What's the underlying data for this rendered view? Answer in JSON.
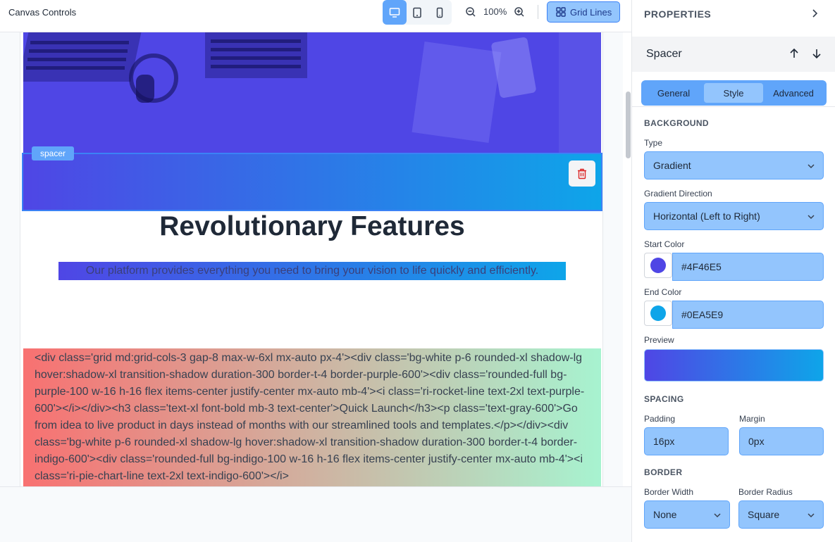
{
  "toolbar": {
    "title": "Canvas Controls",
    "zoom_level": "100%",
    "grid_lines_label": "Grid Lines",
    "devices": [
      "desktop",
      "tablet",
      "mobile"
    ],
    "active_device": "desktop"
  },
  "canvas": {
    "spacer_tag": "spacer",
    "heading": "Revolutionary Features",
    "lead": "Our platform provides everything you need to bring your vision to life quickly and efficiently.",
    "code_text": "<div class='grid md:grid-cols-3 gap-8 max-w-6xl mx-auto px-4'><div class='bg-white p-6 rounded-xl shadow-lg hover:shadow-xl transition-shadow duration-300 border-t-4 border-purple-600'><div class='rounded-full bg-purple-100 w-16 h-16 flex items-center justify-center mx-auto mb-4'><i class='ri-rocket-line text-2xl text-purple-600'></i></div><h3 class='text-xl font-bold mb-3 text-center'>Quick Launch</h3><p class='text-gray-600'>Go from idea to live product in days instead of months with our streamlined tools and templates.</p></div><div class='bg-white p-6 rounded-xl shadow-lg hover:shadow-xl transition-shadow duration-300 border-t-4 border-indigo-600'><div class='rounded-full bg-indigo-100 w-16 h-16 flex items-center justify-center mx-auto mb-4'><i class='ri-pie-chart-line text-2xl text-indigo-600'></i>"
  },
  "panel": {
    "title": "PROPERTIES",
    "element_name": "Spacer",
    "tabs": [
      {
        "label": "General",
        "active": false
      },
      {
        "label": "Style",
        "active": true
      },
      {
        "label": "Advanced",
        "active": false
      }
    ],
    "background": {
      "section_title": "BACKGROUND",
      "type_label": "Type",
      "type_value": "Gradient",
      "direction_label": "Gradient Direction",
      "direction_value": "Horizontal (Left to Right)",
      "start_label": "Start Color",
      "start_value": "#4F46E5",
      "end_label": "End Color",
      "end_value": "#0EA5E9",
      "preview_label": "Preview"
    },
    "spacing": {
      "section_title": "SPACING",
      "padding_label": "Padding",
      "padding_value": "16px",
      "margin_label": "Margin",
      "margin_value": "0px"
    },
    "border": {
      "section_title": "BORDER",
      "width_label": "Border Width",
      "width_value": "None",
      "radius_label": "Border Radius",
      "radius_value": "Square"
    }
  },
  "colors": {
    "accent": "#60a5fa",
    "gradient_start": "#4F46E5",
    "gradient_end": "#0EA5E9"
  }
}
